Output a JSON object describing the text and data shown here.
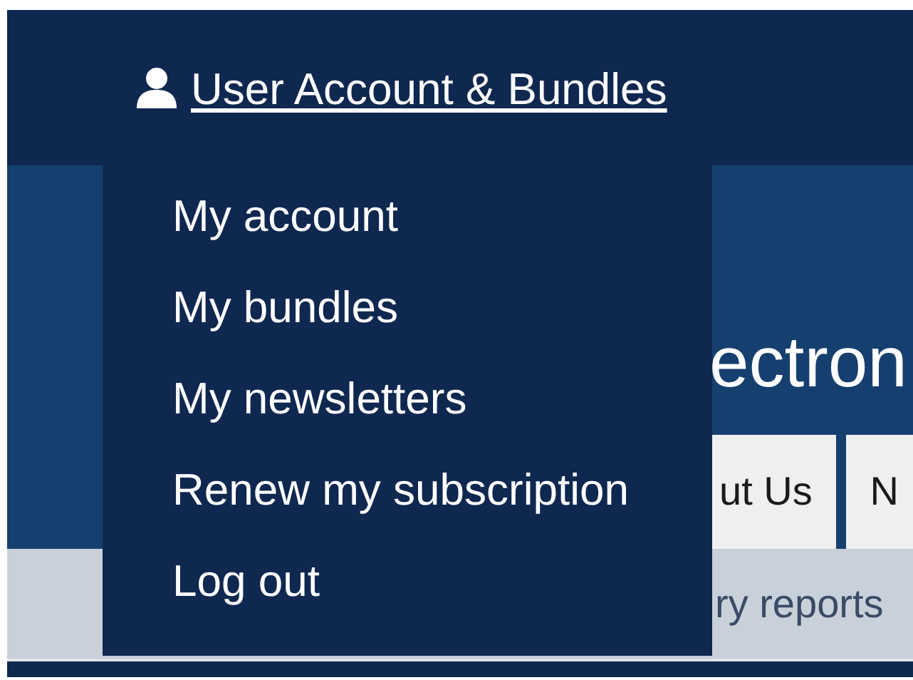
{
  "header": {
    "account_link": "User Account & Bundles"
  },
  "account_menu": {
    "expanded": true,
    "items": [
      {
        "label": "My account"
      },
      {
        "label": "My bundles"
      },
      {
        "label": "My newsletters"
      },
      {
        "label": "Renew my subscription"
      },
      {
        "label": "Log out"
      }
    ]
  },
  "hero": {
    "title": "ectron"
  },
  "nav_tabs": [
    {
      "label": "ut Us"
    },
    {
      "label": "N"
    }
  ],
  "sub_nav": {
    "text": "ry reports"
  }
}
